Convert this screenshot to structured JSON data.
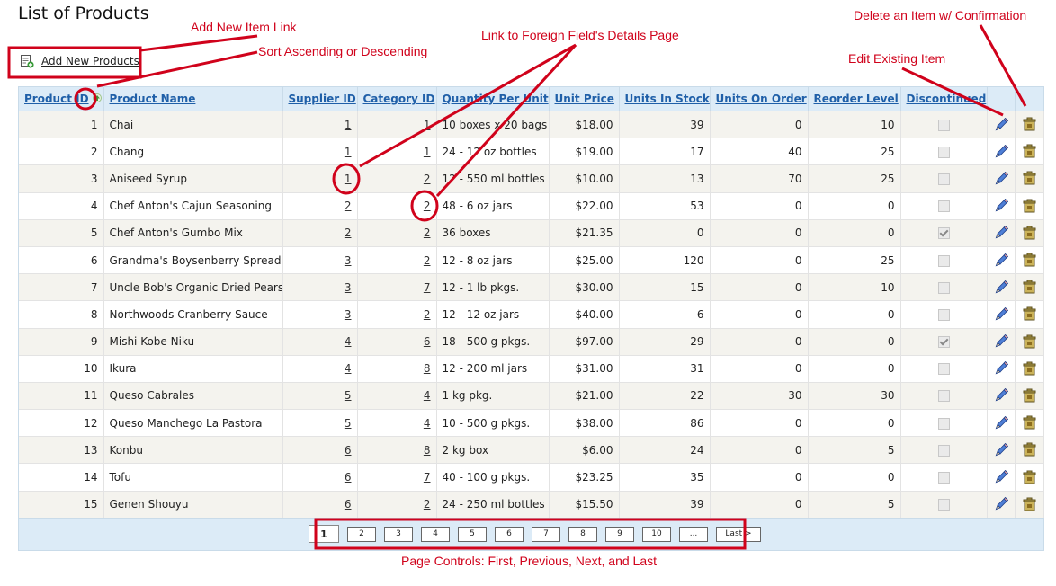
{
  "page": {
    "title": "List of Products"
  },
  "add_new": {
    "label": "Add New Products",
    "icon": "add-item-icon"
  },
  "columns": [
    {
      "key": "product_id",
      "label": "Product ID"
    },
    {
      "key": "product_name",
      "label": "Product Name"
    },
    {
      "key": "supplier_id",
      "label": "Supplier ID"
    },
    {
      "key": "category_id",
      "label": "Category ID"
    },
    {
      "key": "qty",
      "label": "Quantity Per Unit"
    },
    {
      "key": "unit_price",
      "label": "Unit Price"
    },
    {
      "key": "stock",
      "label": "Units In Stock"
    },
    {
      "key": "on_order",
      "label": "Units On Order"
    },
    {
      "key": "reorder",
      "label": "Reorder Level"
    },
    {
      "key": "discontinued",
      "label": "Discontinued"
    }
  ],
  "sort": {
    "column": "product_id",
    "direction": "ascending",
    "icon": "sort-up-arrow-icon"
  },
  "rows": [
    [
      "1",
      "Chai",
      "1",
      "1",
      "10 boxes x 20 bags",
      "$18.00",
      "39",
      "0",
      "10",
      false
    ],
    [
      "2",
      "Chang",
      "1",
      "1",
      "24 - 12 oz bottles",
      "$19.00",
      "17",
      "40",
      "25",
      false
    ],
    [
      "3",
      "Aniseed Syrup",
      "1",
      "2",
      "12 - 550 ml bottles",
      "$10.00",
      "13",
      "70",
      "25",
      false
    ],
    [
      "4",
      "Chef Anton's Cajun Seasoning",
      "2",
      "2",
      "48 - 6 oz jars",
      "$22.00",
      "53",
      "0",
      "0",
      false
    ],
    [
      "5",
      "Chef Anton's Gumbo Mix",
      "2",
      "2",
      "36 boxes",
      "$21.35",
      "0",
      "0",
      "0",
      true
    ],
    [
      "6",
      "Grandma's Boysenberry Spread",
      "3",
      "2",
      "12 - 8 oz jars",
      "$25.00",
      "120",
      "0",
      "25",
      false
    ],
    [
      "7",
      "Uncle Bob's Organic Dried Pears",
      "3",
      "7",
      "12 - 1 lb pkgs.",
      "$30.00",
      "15",
      "0",
      "10",
      false
    ],
    [
      "8",
      "Northwoods Cranberry Sauce",
      "3",
      "2",
      "12 - 12 oz jars",
      "$40.00",
      "6",
      "0",
      "0",
      false
    ],
    [
      "9",
      "Mishi Kobe Niku",
      "4",
      "6",
      "18 - 500 g pkgs.",
      "$97.00",
      "29",
      "0",
      "0",
      true
    ],
    [
      "10",
      "Ikura",
      "4",
      "8",
      "12 - 200 ml jars",
      "$31.00",
      "31",
      "0",
      "0",
      false
    ],
    [
      "11",
      "Queso Cabrales",
      "5",
      "4",
      "1 kg pkg.",
      "$21.00",
      "22",
      "30",
      "30",
      false
    ],
    [
      "12",
      "Queso Manchego La Pastora",
      "5",
      "4",
      "10 - 500 g pkgs.",
      "$38.00",
      "86",
      "0",
      "0",
      false
    ],
    [
      "13",
      "Konbu",
      "6",
      "8",
      "2 kg box",
      "$6.00",
      "24",
      "0",
      "5",
      false
    ],
    [
      "14",
      "Tofu",
      "6",
      "7",
      "40 - 100 g pkgs.",
      "$23.25",
      "35",
      "0",
      "0",
      false
    ],
    [
      "15",
      "Genen Shouyu",
      "6",
      "2",
      "24 - 250 ml bottles",
      "$15.50",
      "39",
      "0",
      "5",
      false
    ]
  ],
  "row_icons": {
    "edit": "pencil-edit-icon",
    "delete": "trash-delete-icon"
  },
  "pager": {
    "pages": [
      "1",
      "2",
      "3",
      "4",
      "5",
      "6",
      "7",
      "8",
      "9",
      "10",
      "..."
    ],
    "current": "1",
    "last_label": "Last >"
  },
  "annotations": {
    "add_new_link": "Add New Item Link",
    "sort": "Sort Ascending or Descending",
    "foreign": "Link to Foreign Field's Details Page",
    "delete": "Delete an Item w/ Confirmation",
    "edit": "Edit Existing Item",
    "pager": "Page Controls: First, Previous, Next, and Last"
  },
  "colors": {
    "annotation": "#d0021b",
    "header_bg": "#dcebf7",
    "link": "#1f5fa8"
  }
}
